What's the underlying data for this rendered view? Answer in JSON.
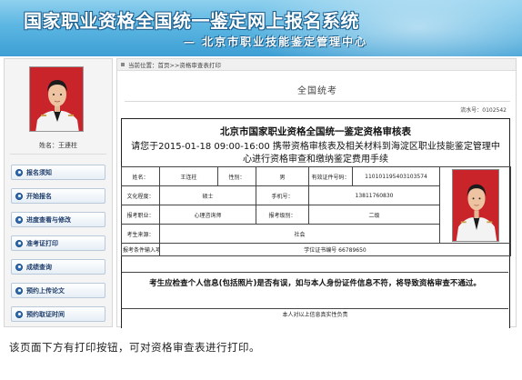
{
  "header": {
    "title": "国家职业资格全国统一鉴定网上报名系统",
    "subtitle": "— 北京市职业技能鉴定管理中心"
  },
  "sidebar": {
    "name_label": "姓名：王連柱",
    "items": [
      {
        "label": "报名须知",
        "icon": "bullet-icon"
      },
      {
        "label": "开始报名",
        "icon": "bullet-icon"
      },
      {
        "label": "进度查看与修改",
        "icon": "bullet-icon"
      },
      {
        "label": "准考证打印",
        "icon": "bullet-icon"
      },
      {
        "label": "成绩查询",
        "icon": "bullet-icon"
      },
      {
        "label": "预约上传论文",
        "icon": "bullet-icon"
      },
      {
        "label": "预约取证时间",
        "icon": "bullet-icon"
      }
    ]
  },
  "main": {
    "breadcrumb": "当前位置：首页>>资格审查表打印",
    "heading": "全国统考",
    "serial": "流水号：0102542"
  },
  "form": {
    "title": "北京市国家职业资格全国统一鉴定资格审核表",
    "notice": "请您于2015-01-18 09:00-16:00 携带资格审核表及相关材料到海淀区职业技能鉴定管理中心进行资格审查和缴纳鉴定费用手续",
    "rows": {
      "name_label": "姓名：",
      "name_value": "王连柱",
      "gender_label": "性别：",
      "gender_value": "男",
      "id_label": "有效证件号码：",
      "id_value": "110101195403103574",
      "education_label": "文化程度：",
      "education_value": "硕士",
      "phone_label": "手机号：",
      "phone_value": "13811760830",
      "occupation_label": "报考职业：",
      "occupation_value": "心理咨询师",
      "level_label": "报考级别：",
      "level_value": "二级",
      "source_label": "考生来源：",
      "source_value": "社会",
      "condition_label": "报考条件输入项",
      "condition_value": "学位证书编号 66789650"
    },
    "warning": "考生应检查个人信息(包括照片)是否有误，如与本人身份证件信息不符，将导致资格审查不通过。",
    "confirm": "本人对以上信息真实性负责"
  },
  "caption": "该页面下方有打印按钮，可对资格审查表进行打印。",
  "colors": {
    "banner": "#5cb6e2",
    "menu_text": "#1e3d6b",
    "photo_background": "#c8242a"
  }
}
